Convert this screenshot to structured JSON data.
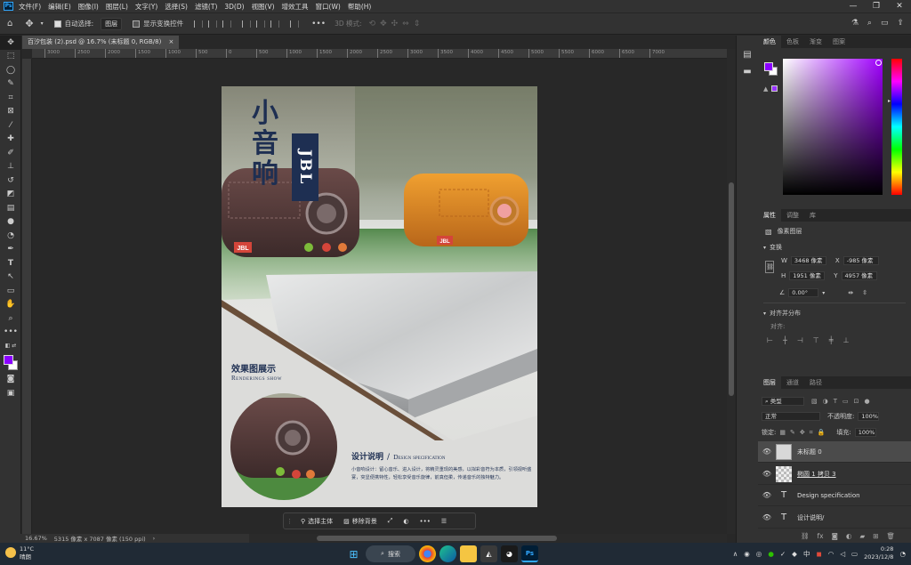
{
  "menubar": {
    "logo": "Ps",
    "items": [
      "文件(F)",
      "编辑(E)",
      "图像(I)",
      "图层(L)",
      "文字(Y)",
      "选择(S)",
      "滤镜(T)",
      "3D(D)",
      "视图(V)",
      "增效工具",
      "窗口(W)",
      "帮助(H)"
    ],
    "controls": [
      "—",
      "❐",
      "✕"
    ]
  },
  "options_bar": {
    "auto_select_label": "自动选择:",
    "auto_select_value": "图层",
    "transform_controls_label": "显示变换控件",
    "mode_3d_label": "3D 模式:"
  },
  "document": {
    "tab_label": "百汐包装 (2).psd @ 16.7% (未标题 0, RGB/8)",
    "tab_close": "×",
    "ruler_marks": [
      "3000",
      "2500",
      "2000",
      "1500",
      "1000",
      "500",
      "0",
      "500",
      "1000",
      "1500",
      "2000",
      "2500",
      "3000",
      "3500",
      "4000",
      "4500",
      "5000",
      "5500",
      "6000",
      "6500",
      "7000"
    ]
  },
  "artwork": {
    "title_chars": [
      "小",
      "音",
      "响"
    ],
    "brand_label": "JBL",
    "speaker_brand": "JBL",
    "renderings_cn": "效果图展示",
    "renderings_en": "Renderings show",
    "design_title_cn": "设计说明",
    "design_title_sep": "/",
    "design_title_en": "Design specification",
    "design_body": "小音响设计：留心音乐、进入设计，将精灵重现的美感，以拟彩音符为本质，引领视听盛宴，突显便携特性，轻松享受音乐旋律，前真但柔，传递音乐的独特魅力。"
  },
  "statusbar": {
    "zoom": "16.67%",
    "doc_info": "5315 像素 x 7087 像素 (150 ppi)"
  },
  "context_bar": {
    "select_subject": "选择主体",
    "remove_bg": "移除背景",
    "more": "•••"
  },
  "color_panel": {
    "tabs": [
      "颜色",
      "色板",
      "渐变",
      "图案"
    ],
    "fg_color": "#8b00ff",
    "bg_color": "#ffffff",
    "picker_hue": "#a000ff"
  },
  "properties_panel": {
    "tabs": [
      "属性",
      "调整",
      "库"
    ],
    "type_label": "像素图层",
    "transform_label": "变换",
    "w_label": "W",
    "w_value": "3468 像素",
    "x_label": "X",
    "x_value": "-985 像素",
    "h_label": "H",
    "h_value": "1951 像素",
    "y_label": "Y",
    "y_value": "4957 像素",
    "angle_value": "0.00°",
    "align_label": "对齐并分布",
    "align_sub": "对齐:"
  },
  "layers_panel": {
    "tabs": [
      "图层",
      "通道",
      "路径"
    ],
    "filter_label": "类型",
    "blend_mode": "正常",
    "opacity_label": "不透明度:",
    "opacity_value": "100%",
    "lock_label": "锁定:",
    "fill_label": "填充:",
    "fill_value": "100%",
    "layers": [
      {
        "name": "未标题 0",
        "kind": "pixel",
        "selected": true
      },
      {
        "name": "椭圆 1 拷贝 3",
        "kind": "shape",
        "selected": false
      },
      {
        "name": "Design specification",
        "kind": "text",
        "selected": false
      },
      {
        "name": "设计说明/",
        "kind": "text",
        "selected": false
      }
    ],
    "text_glyph": "T"
  },
  "taskbar": {
    "temperature": "11°C",
    "weather": "晴朗",
    "search_label": "搜索",
    "ime_label": "中",
    "time": "0:28",
    "date": "2023/12/8"
  }
}
